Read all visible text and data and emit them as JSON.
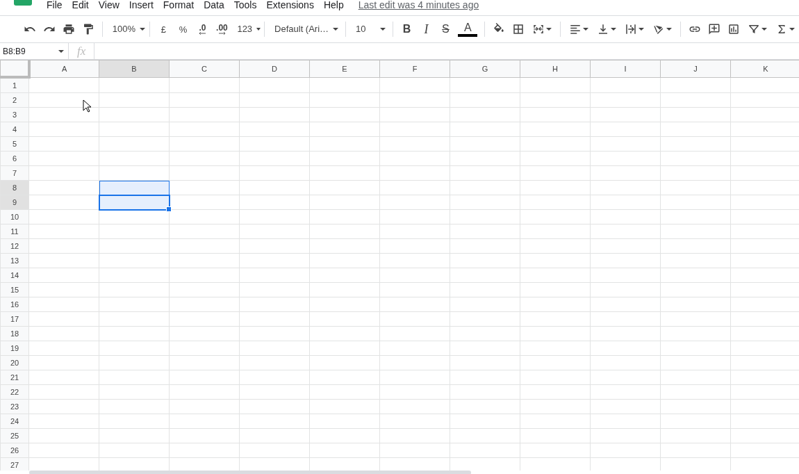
{
  "menu": [
    "File",
    "Edit",
    "View",
    "Insert",
    "Format",
    "Data",
    "Tools",
    "Extensions",
    "Help"
  ],
  "last_edit": "Last edit was 4 minutes ago",
  "toolbar": {
    "zoom": "100%",
    "currency": "£",
    "percent": "%",
    "decrease_decimals": ".0",
    "increase_decimals": ".00",
    "more_formats": "123",
    "font": "Default (Ari…",
    "font_size": "10",
    "bold": "B",
    "italic": "I",
    "strikethrough": "S",
    "text_color": "A"
  },
  "formula_bar": {
    "name_box": "B8:B9",
    "fx": "fx"
  },
  "columns": [
    {
      "label": "A",
      "selected": false
    },
    {
      "label": "B",
      "selected": true
    },
    {
      "label": "C",
      "selected": false
    },
    {
      "label": "D",
      "selected": false
    },
    {
      "label": "E",
      "selected": false
    },
    {
      "label": "F",
      "selected": false
    },
    {
      "label": "G",
      "selected": false
    },
    {
      "label": "H",
      "selected": false
    },
    {
      "label": "I",
      "selected": false
    },
    {
      "label": "J",
      "selected": false
    },
    {
      "label": "K",
      "selected": false
    }
  ],
  "rows": [
    {
      "label": "1",
      "selected": false,
      "active": false
    },
    {
      "label": "2",
      "selected": false,
      "active": false
    },
    {
      "label": "3",
      "selected": false,
      "active": false
    },
    {
      "label": "4",
      "selected": false,
      "active": false
    },
    {
      "label": "5",
      "selected": false,
      "active": false
    },
    {
      "label": "6",
      "selected": false,
      "active": false
    },
    {
      "label": "7",
      "selected": false,
      "active": false
    },
    {
      "label": "8",
      "selected": true,
      "active": false
    },
    {
      "label": "9",
      "selected": true,
      "active": true
    },
    {
      "label": "10",
      "selected": false,
      "active": false
    },
    {
      "label": "11",
      "selected": false,
      "active": false
    },
    {
      "label": "12",
      "selected": false,
      "active": false
    },
    {
      "label": "13",
      "selected": false,
      "active": false
    },
    {
      "label": "14",
      "selected": false,
      "active": false
    },
    {
      "label": "15",
      "selected": false,
      "active": false
    },
    {
      "label": "16",
      "selected": false,
      "active": false
    },
    {
      "label": "17",
      "selected": false,
      "active": false
    },
    {
      "label": "18",
      "selected": false,
      "active": false
    },
    {
      "label": "19",
      "selected": false,
      "active": false
    },
    {
      "label": "20",
      "selected": false,
      "active": false
    },
    {
      "label": "21",
      "selected": false,
      "active": false
    },
    {
      "label": "22",
      "selected": false,
      "active": false
    },
    {
      "label": "23",
      "selected": false,
      "active": false
    },
    {
      "label": "24",
      "selected": false,
      "active": false
    },
    {
      "label": "25",
      "selected": false,
      "active": false
    },
    {
      "label": "26",
      "selected": false,
      "active": false
    },
    {
      "label": "27",
      "selected": false,
      "active": false
    }
  ]
}
